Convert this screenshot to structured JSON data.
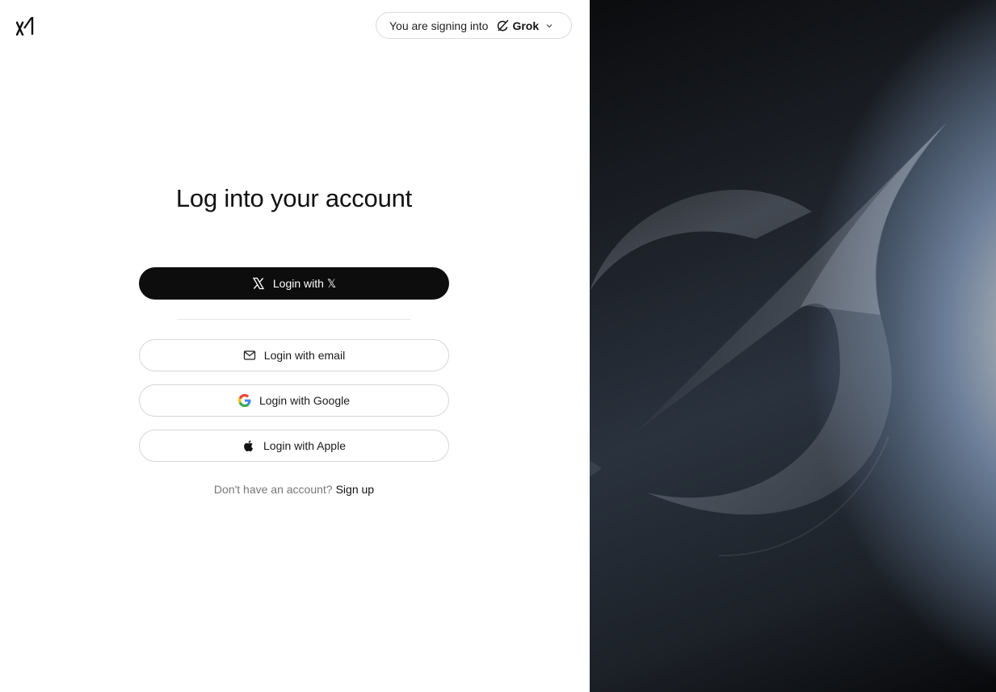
{
  "header": {
    "signing_prefix": "You are signing into",
    "product_name": "Grok"
  },
  "main": {
    "title": "Log into your account",
    "buttons": {
      "x_label": "Login with 𝕏",
      "email_label": "Login with email",
      "google_label": "Login with Google",
      "apple_label": "Login with Apple"
    },
    "signup_prompt": "Don't have an account?",
    "signup_link": "Sign up"
  },
  "icons": {
    "logo": "xai-logo-icon",
    "product": "grok-icon",
    "dropdown": "chevron-down-icon",
    "x": "x-icon",
    "email": "mail-icon",
    "google": "google-icon",
    "apple": "apple-icon"
  },
  "colors": {
    "primary_button": "#0d0d0d",
    "primary_text": "#ffffff",
    "border": "#d6d6d6",
    "muted_text": "#777777"
  }
}
